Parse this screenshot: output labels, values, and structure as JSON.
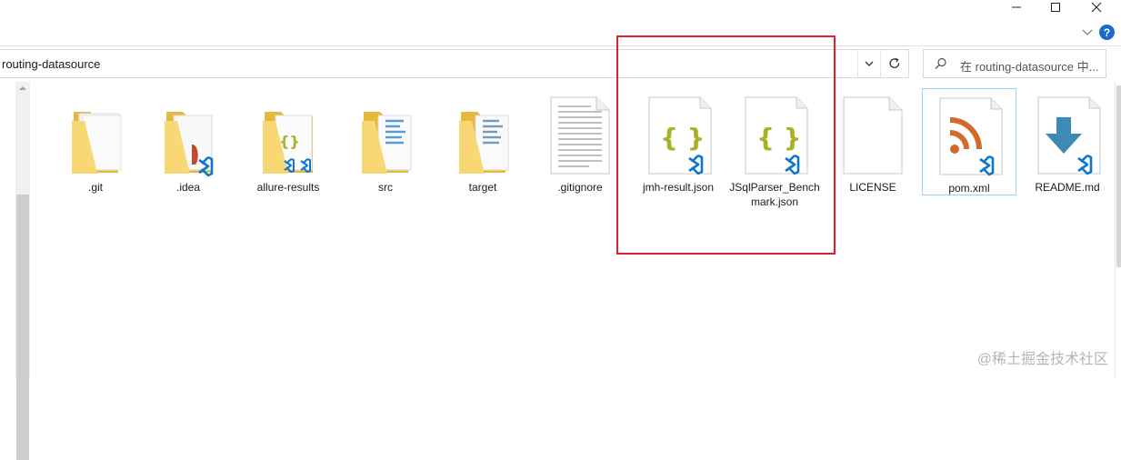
{
  "window": {
    "caption_buttons": [
      "minimize-icon",
      "maximize-icon",
      "close-icon"
    ],
    "help_label": "?"
  },
  "address_bar": {
    "path": "routing-datasource"
  },
  "search": {
    "placeholder": "在 routing-datasource 中..."
  },
  "files": [
    {
      "name": ".git",
      "type": "folder"
    },
    {
      "name": ".idea",
      "type": "folder"
    },
    {
      "name": "allure-results",
      "type": "folder"
    },
    {
      "name": "src",
      "type": "folder"
    },
    {
      "name": "target",
      "type": "folder"
    },
    {
      "name": ".gitignore",
      "type": "text-file"
    },
    {
      "name": "jmh-result.json",
      "type": "json-file"
    },
    {
      "name": "JSqlParser_Benchmark.json",
      "type": "json-file"
    },
    {
      "name": "LICENSE",
      "type": "file"
    },
    {
      "name": "pom.xml",
      "type": "xml-file",
      "selected": true
    },
    {
      "name": "README.md",
      "type": "markdown-file"
    }
  ],
  "watermark": "@稀土掘金技术社区",
  "colors": {
    "folder": "#f8d775",
    "folder_dark": "#e8b83c",
    "vscode_blue": "#0e77c9",
    "json_brace": "#a8b226",
    "rss_orange": "#d3692b",
    "md_arrow": "#3d8bb5",
    "highlight": "#e0202b",
    "selection_border": "#99d1ff"
  }
}
